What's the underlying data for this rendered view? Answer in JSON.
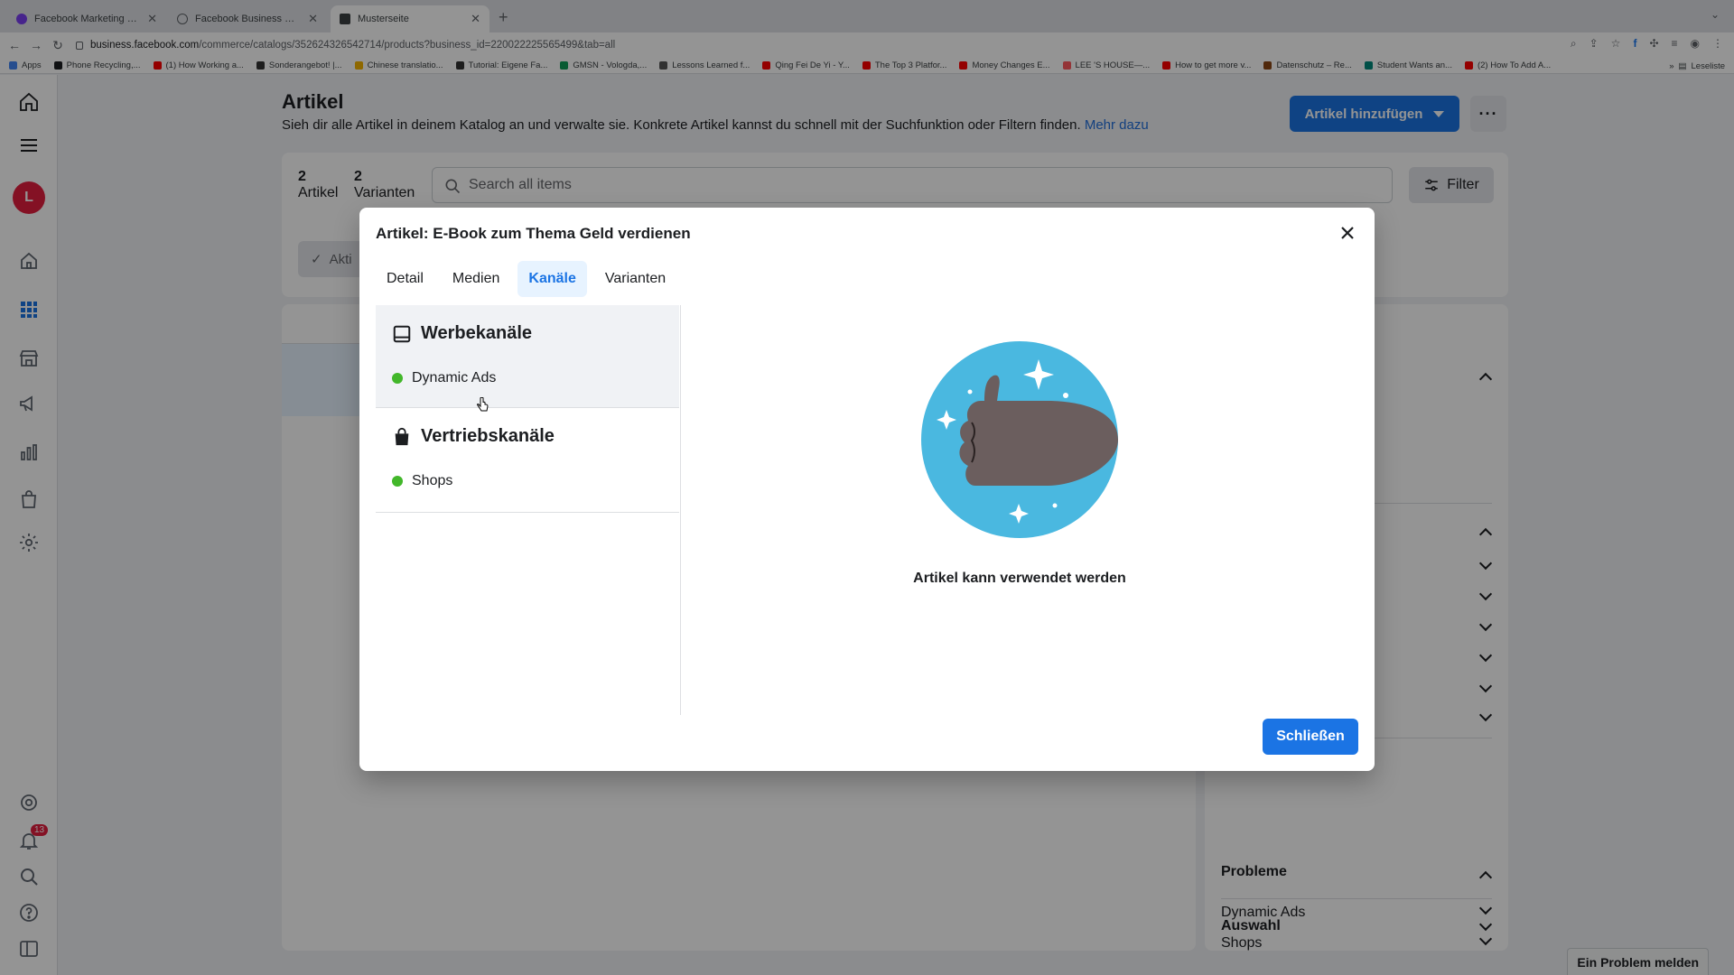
{
  "browser": {
    "tabs": [
      {
        "label": "Facebook Marketing & Werbe...",
        "color": "#7b3ff2"
      },
      {
        "label": "Facebook Business Suite",
        "color": "#5f6368"
      },
      {
        "label": "Musterseite",
        "color": "#3c4043"
      }
    ],
    "new_tab": "+",
    "url_host": "business.facebook.com",
    "url_path": "/commerce/catalogs/352624326542714/products?business_id=220022225565499&tab=all",
    "bookmarks": [
      {
        "label": "Apps",
        "color": "#4285f4"
      },
      {
        "label": "Phone Recycling,...",
        "color": "#1c1e21"
      },
      {
        "label": "(1) How Working a...",
        "color": "#ff0000"
      },
      {
        "label": "Sonderangebot! |...",
        "color": "#333333"
      },
      {
        "label": "Chinese translatio...",
        "color": "#f4b400"
      },
      {
        "label": "Tutorial: Eigene Fa...",
        "color": "#333333"
      },
      {
        "label": "GMSN - Vologda,...",
        "color": "#0f9d58"
      },
      {
        "label": "Lessons Learned f...",
        "color": "#555555"
      },
      {
        "label": "Qing Fei De Yi - Y...",
        "color": "#ff0000"
      },
      {
        "label": "The Top 3 Platfor...",
        "color": "#ff0000"
      },
      {
        "label": "Money Changes E...",
        "color": "#ff0000"
      },
      {
        "label": "LEE 'S HOUSE—...",
        "color": "#ff5a5f"
      },
      {
        "label": "How to get more v...",
        "color": "#ff0000"
      },
      {
        "label": "Datenschutz – Re...",
        "color": "#8b4513"
      },
      {
        "label": "Student Wants an...",
        "color": "#00897b"
      },
      {
        "label": "(2) How To Add A...",
        "color": "#ff0000"
      }
    ],
    "overflow": "»",
    "reading_list": "Leseliste"
  },
  "nav": {
    "avatar_letter": "L",
    "notifications_count": "13"
  },
  "page": {
    "title": "Artikel",
    "description": "Sieh dir alle Artikel in deinem Katalog an und verwalte sie. Konkrete Artikel kannst du schnell mit der Suchfunktion oder Filtern finden.",
    "description_link": "Mehr dazu",
    "add_button": "Artikel hinzufügen",
    "more_button": "···",
    "items_count": "2",
    "items_label": "Artikel",
    "variants_count": "2",
    "variants_label": "Varianten",
    "search_placeholder": "Search all items",
    "filter_button": "Filter",
    "status_chip": "Akti"
  },
  "sidebar": {
    "problems_title": "Probleme",
    "problems_items": [
      "Dynamic Ads",
      "Shops"
    ],
    "selection_title": "Auswahl"
  },
  "report_button": "Ein Problem melden",
  "modal": {
    "title": "Artikel: E-Book zum Thema Geld verdienen",
    "tabs": [
      "Detail",
      "Medien",
      "Kanäle",
      "Varianten"
    ],
    "active_tab": "Kanäle",
    "groups": [
      {
        "title": "Werbekanäle",
        "icon": "ads-channel-icon",
        "item": "Dynamic Ads"
      },
      {
        "title": "Vertriebskanäle",
        "icon": "shopping-bag-icon",
        "item": "Shops"
      }
    ],
    "status_color": "#42b72a",
    "status_text": "Artikel kann verwendet werden",
    "close_button": "Schließen"
  },
  "colors": {
    "accent": "#1b74e4",
    "illustration_bg": "#4ab8e0",
    "illustration_hand": "#6b5e5e"
  }
}
